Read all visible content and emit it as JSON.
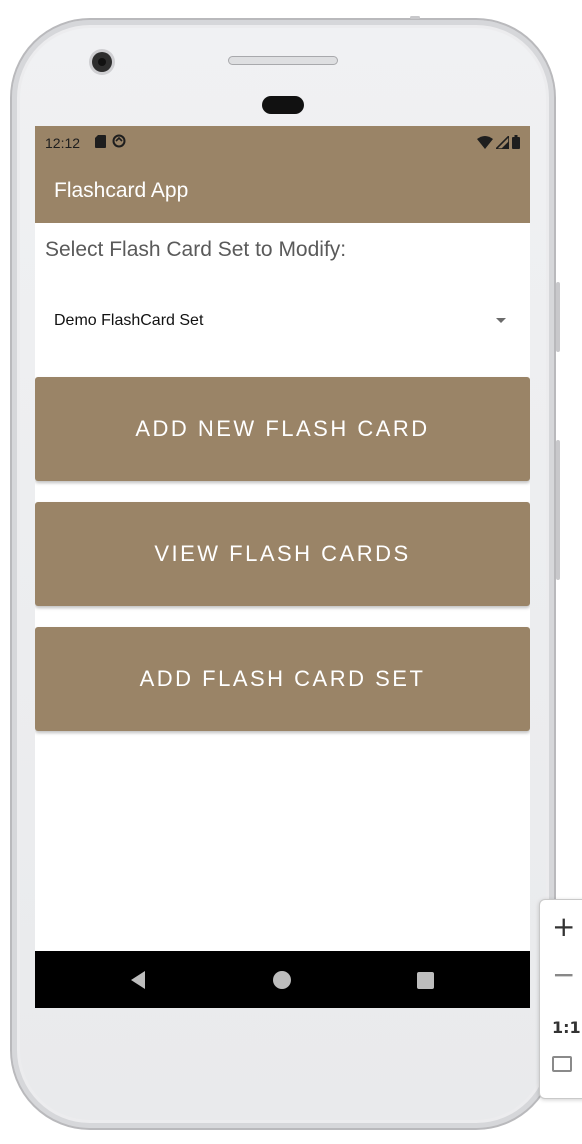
{
  "status_bar": {
    "time": "12:12",
    "left_icons": [
      "sd-card-icon",
      "sync-circle-icon"
    ],
    "right_icons": [
      "wifi-icon",
      "cell-signal-icon",
      "battery-icon"
    ]
  },
  "app_bar": {
    "title": "Flashcard App"
  },
  "main": {
    "prompt": "Select Flash Card Set to Modify:",
    "set_selector": {
      "selected": "Demo FlashCard Set"
    },
    "buttons": {
      "add_card": "ADD NEW FLASH CARD",
      "view_cards": "VIEW FLASH CARDS",
      "add_set": "ADD FLASH CARD SET"
    }
  },
  "nav_bar": {
    "icons": [
      "back-icon",
      "home-icon",
      "recents-icon"
    ]
  },
  "zoom_panel": {
    "zoom_in": "+",
    "zoom_out": "−",
    "reset": "1:1"
  },
  "colors": {
    "primary": "#9a8467",
    "nav_bar": "#000000",
    "button_text": "#ffffff",
    "prompt_text": "#5a5a5a"
  }
}
